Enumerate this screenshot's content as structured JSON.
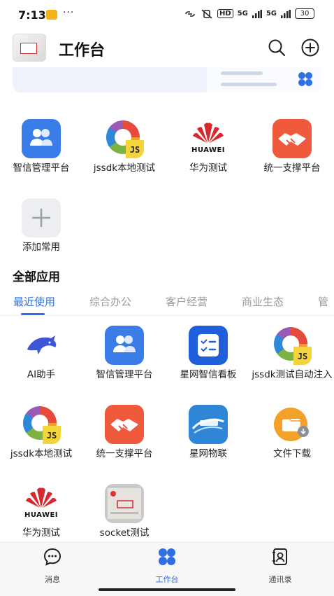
{
  "status_bar": {
    "time": "7:13",
    "dots": "···",
    "hd": "HD",
    "signal1": "5G",
    "signal2": "5G",
    "battery": "30"
  },
  "header": {
    "title": "工作台"
  },
  "favorites": [
    {
      "label": "智信管理平台",
      "icon": "people-icon"
    },
    {
      "label": "jssdk本地测试",
      "icon": "jssdk-icon"
    },
    {
      "label": "华为测试",
      "icon": "huawei-icon"
    },
    {
      "label": "统一支撑平台",
      "icon": "handshake-icon"
    },
    {
      "label": "添加常用",
      "icon": "plus-icon"
    }
  ],
  "huawei_word": "HUAWEI",
  "section": {
    "title": "全部应用"
  },
  "tabs": [
    {
      "label": "最近使用",
      "active": true
    },
    {
      "label": "综合办公",
      "active": false
    },
    {
      "label": "客户经营",
      "active": false
    },
    {
      "label": "商业生态",
      "active": false
    },
    {
      "label": "管",
      "active": false
    }
  ],
  "apps": [
    {
      "label": "AI助手",
      "icon": "dolphin-icon"
    },
    {
      "label": "智信管理平台",
      "icon": "people-icon"
    },
    {
      "label": "星网智信看板",
      "icon": "board-icon"
    },
    {
      "label": "jssdk测试自动注入",
      "icon": "jssdk-icon"
    },
    {
      "label": "jssdk本地测试",
      "icon": "jssdk-icon"
    },
    {
      "label": "统一支撑平台",
      "icon": "handshake-icon"
    },
    {
      "label": "星网物联",
      "icon": "iot-icon"
    },
    {
      "label": "文件下载",
      "icon": "folder-download-icon"
    },
    {
      "label": "华为测试",
      "icon": "huawei-icon"
    },
    {
      "label": "socket测试",
      "icon": "certificate-icon"
    }
  ],
  "nav": [
    {
      "label": "消息",
      "icon": "chat-icon"
    },
    {
      "label": "工作台",
      "icon": "workbench-icon",
      "active": true
    },
    {
      "label": "通讯录",
      "icon": "contacts-icon"
    }
  ],
  "colors": {
    "accent": "#2f6fe0",
    "huawei_red": "#d7282f",
    "handshake_orange": "#ef5a3c"
  }
}
